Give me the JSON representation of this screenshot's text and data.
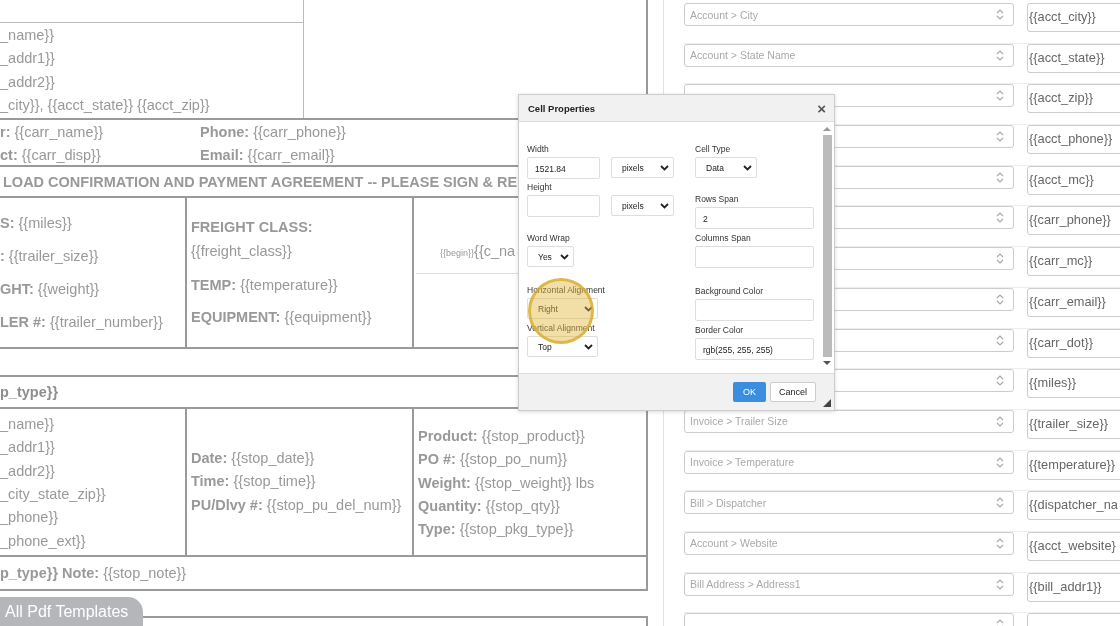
{
  "document": {
    "account_lines": [
      "_name}}",
      "_addr1}}",
      "_addr2}}",
      "_city}}, {{acct_state}} {{acct_zip}}"
    ],
    "carrier_rows": [
      {
        "left": "**r:** {{carr_name}}",
        "right": "**Phone:** {{carr_phone}}"
      },
      {
        "left": "**ct:** {{carr_disp}}",
        "right": "**Email:** {{carr_email}}"
      }
    ],
    "agreement_title": "LOAD CONFIRMATION AND PAYMENT AGREEMENT -- PLEASE SIGN & RE",
    "freight_col1": [
      "**S:** {{miles}}",
      "**:** {{trailer_size}}",
      "**GHT:** {{weight}}",
      "**LER #:** {{trailer_number}}"
    ],
    "freight_col2": [
      "**FREIGHT CLASS:**",
      "{{freight_class}}",
      "**TEMP:** {{temperature}}",
      "**EQUIPMENT:** {{equipment}}"
    ],
    "begin_tag": "{{begin}}",
    "c_name": "{{c_na",
    "stop_header": "p_type}}",
    "stop_col1": [
      "_name}}",
      "_addr1}}",
      "_addr2}}",
      "_city_state_zip}}",
      "_phone}}",
      "_phone_ext}}"
    ],
    "stop_col2": [
      "**Date:** {{stop_date}}",
      "**Time:** {{stop_time}}",
      "**PU/Dlvy #:** {{stop_pu_del_num}}"
    ],
    "stop_col3": [
      "**Product:** {{stop_product}}",
      "**PO #:** {{stop_po_num}}",
      "**Weight:** {{stop_weight}} lbs",
      "**Quantity:** {{stop_qty}}",
      "**Type:** {{stop_pkg_type}}"
    ],
    "note": "**p_type}} Note:** {{stop_note}}",
    "templates_tab": "All Pdf Templates"
  },
  "mapping_rows": [
    {
      "field": "Account > City",
      "token": "{{acct_city}}"
    },
    {
      "field": "Account > State Name",
      "token": "{{acct_state}}"
    },
    {
      "token": "{{acct_zip}}"
    },
    {
      "token": "{{acct_phone}}"
    },
    {
      "token": "{{acct_mc}}"
    },
    {
      "token": "{{carr_phone}}"
    },
    {
      "token": "{{carr_mc}}"
    },
    {
      "token": "{{carr_email}}"
    },
    {
      "token": "{{carr_dot}}"
    },
    {
      "token": "{{miles}}"
    },
    {
      "field": "Invoice > Trailer Size",
      "token": "{{trailer_size}}"
    },
    {
      "field": "Invoice > Temperature",
      "token": "{{temperature}}"
    },
    {
      "field": "Bill > Dispatcher",
      "token": "{{dispatcher_na"
    },
    {
      "field": "Account > Website",
      "token": "{{acct_website}"
    },
    {
      "field": "Bill Address > Address1",
      "token": "{{bill_addr1}}"
    },
    {}
  ],
  "dialog": {
    "title": "Cell Properties",
    "close": "×",
    "left_fields": [
      {
        "label": "Width",
        "kind": "input_unit",
        "value": "1521.84",
        "unit": "pixels"
      },
      {
        "label": "Height",
        "kind": "input_unit",
        "unit": "pixels"
      },
      {
        "label": "Word Wrap",
        "kind": "select",
        "value": "Yes"
      },
      {
        "label": "Horizontal Alignment",
        "kind": "select",
        "value": "Right"
      },
      {
        "label": "Vertical Alignment",
        "kind": "select",
        "value": "Top"
      }
    ],
    "right_fields": [
      {
        "label": "Cell Type",
        "kind": "select",
        "value": "Data"
      },
      {
        "label": "Rows Span",
        "kind": "input",
        "value": "2"
      },
      {
        "label": "Columns Span",
        "kind": "input"
      },
      {
        "label": "Background Color",
        "kind": "input"
      },
      {
        "label": "Border Color",
        "kind": "input",
        "value": "rgb(255, 255, 255)"
      }
    ],
    "ok": "OK",
    "cancel": "Cancel"
  }
}
